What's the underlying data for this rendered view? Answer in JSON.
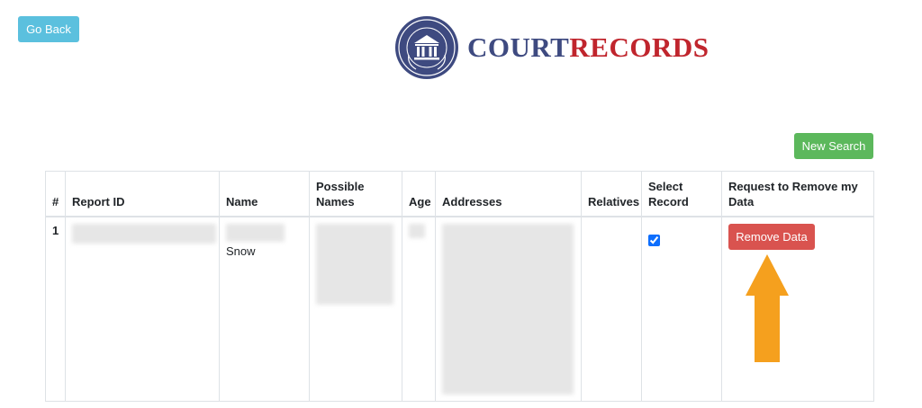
{
  "header": {
    "go_back_label": "Go Back",
    "logo": {
      "seal_text": "COURT RECORDS",
      "text_part1": "COURT",
      "text_part2": "RECORDS"
    }
  },
  "toolbar": {
    "new_search_label": "New Search"
  },
  "table": {
    "columns": [
      "#",
      "Report ID",
      "Name",
      "Possible Names",
      "Age",
      "Addresses",
      "Relatives",
      "Select Record",
      "Request to Remove my Data"
    ],
    "rows": [
      {
        "number": "1",
        "report_id": "",
        "name": "Snow",
        "possible_names": "",
        "age": "",
        "addresses": "",
        "relatives": "",
        "selected": true,
        "action_label": "Remove Data"
      }
    ]
  },
  "colors": {
    "go_back": "#5bc0de",
    "new_search": "#5cb85c",
    "remove_data": "#d9534f",
    "logo_blue": "#3e4a80",
    "logo_red": "#c0252d",
    "annotation_arrow": "#f5a01e"
  }
}
